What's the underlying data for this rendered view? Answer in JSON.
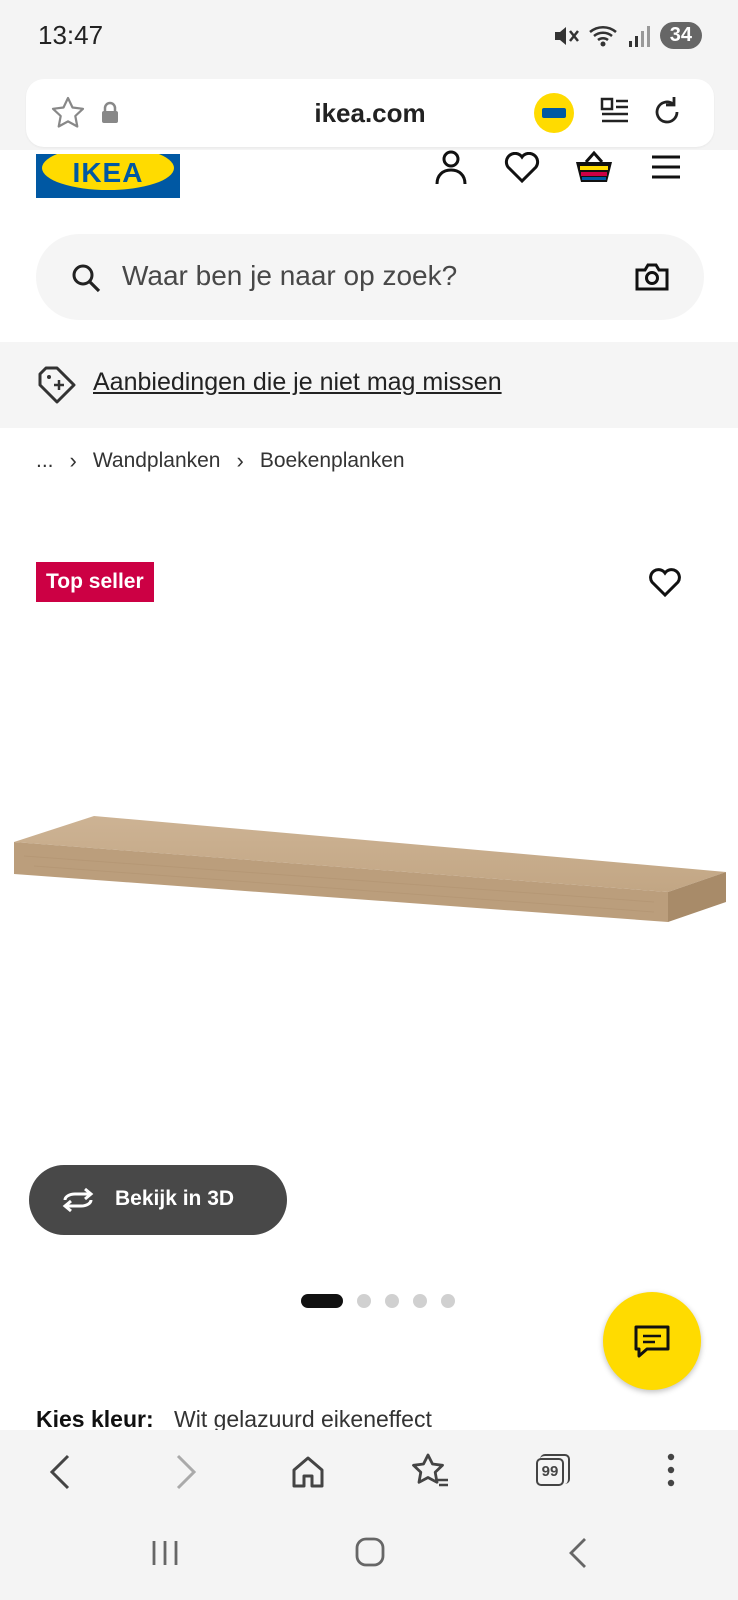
{
  "status_bar": {
    "time": "13:47",
    "battery": "34"
  },
  "browser": {
    "url": "ikea.com"
  },
  "header": {
    "logo_text": "IKEA"
  },
  "search": {
    "placeholder": "Waar ben je naar op zoek?"
  },
  "promo": {
    "text": "Aanbiedingen die je niet mag missen"
  },
  "breadcrumb": {
    "items": [
      "...",
      "Wandplanken",
      "Boekenplanken"
    ]
  },
  "product": {
    "badge": "Top seller",
    "view_3d_label": "Bekijk in 3D",
    "image_count": 5,
    "active_image_index": 0,
    "color_label": "Kies kleur:",
    "color_value": "Wit gelazuurd eikeneffect"
  },
  "colors": {
    "ikea_blue": "#0058a3",
    "ikea_yellow": "#ffdb00",
    "badge_red": "#cc0044",
    "button_dark": "#484848"
  }
}
